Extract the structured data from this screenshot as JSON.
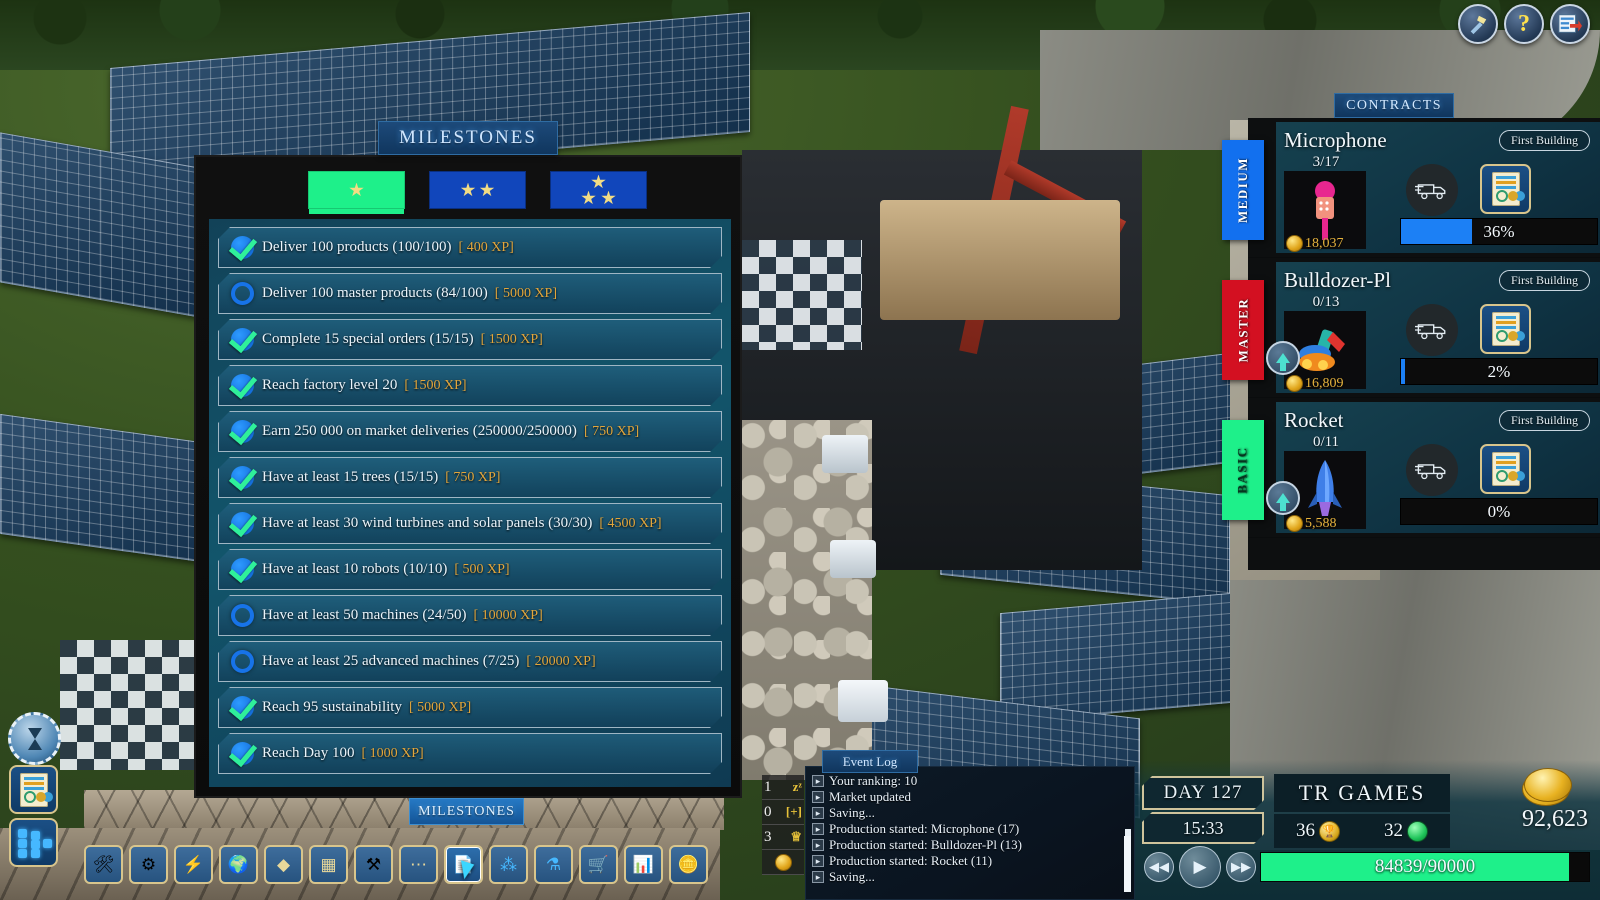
{
  "top_icons": [
    {
      "name": "hammer-tool-icon",
      "glyph": "🔨"
    },
    {
      "name": "help-icon",
      "glyph": "?"
    },
    {
      "name": "exit-icon",
      "glyph": "➡"
    }
  ],
  "milestones": {
    "window_title": "MILESTONES",
    "bottom_label": "MILESTONES",
    "tabs": [
      {
        "label": "1-star",
        "stars": 1,
        "active": true
      },
      {
        "label": "2-star",
        "stars": 2,
        "active": false
      },
      {
        "label": "3-star",
        "stars": 3,
        "active": false
      }
    ],
    "items": [
      {
        "text": "Deliver 100 products (100/100)",
        "xp": "[ 400 XP]",
        "done": true
      },
      {
        "text": "Deliver 100 master products (84/100)",
        "xp": "[ 5000 XP]",
        "done": false
      },
      {
        "text": "Complete 15 special orders (15/15)",
        "xp": "[ 1500 XP]",
        "done": true
      },
      {
        "text": "Reach factory level 20",
        "xp": "[ 1500 XP]",
        "done": true
      },
      {
        "text": "Earn 250 000 on market deliveries (250000/250000)",
        "xp": "[ 750 XP]",
        "done": true
      },
      {
        "text": "Have at least 15 trees (15/15)",
        "xp": "[ 750 XP]",
        "done": true
      },
      {
        "text": "Have at least 30 wind turbines and solar panels (30/30)",
        "xp": "[ 4500 XP]",
        "done": true
      },
      {
        "text": "Have at least 10 robots (10/10)",
        "xp": "[ 500 XP]",
        "done": true
      },
      {
        "text": "Have at least 50 machines (24/50)",
        "xp": "[ 10000 XP]",
        "done": false
      },
      {
        "text": "Have at least 25 advanced machines (7/25)",
        "xp": "[ 20000 XP]",
        "done": false
      },
      {
        "text": "Reach 95 sustainability",
        "xp": "[ 5000 XP]",
        "done": true
      },
      {
        "text": "Reach Day 100",
        "xp": "[ 1000 XP]",
        "done": true
      }
    ]
  },
  "contracts": {
    "title": "CONTRACTS",
    "rows": [
      {
        "tier": "MEDIUM",
        "tier_color": "#1270ef",
        "name": "Microphone",
        "badge": "First Building",
        "count": "3/17",
        "cost": "18,037",
        "progress_pct": "36%",
        "progress_value": 36,
        "product_icon": "microphone-icon",
        "has_upgrade": false
      },
      {
        "tier": "MASTER",
        "tier_color": "#d31021",
        "name": "Bulldozer-Pl",
        "badge": "First Building",
        "count": "0/13",
        "cost": "16,809",
        "progress_pct": "2%",
        "progress_value": 2,
        "product_icon": "bulldozer-icon",
        "has_upgrade": true
      },
      {
        "tier": "BASIC",
        "tier_color": "#1ef08a",
        "name": "Rocket",
        "badge": "First Building",
        "count": "0/11",
        "cost": "5,588",
        "progress_pct": "0%",
        "progress_value": 0,
        "product_icon": "rocket-icon",
        "has_upgrade": true
      }
    ]
  },
  "event_log": {
    "title": "Event Log",
    "lines": [
      "Your ranking: 10",
      "Market updated",
      "Saving...",
      "Production started: Microphone (17)",
      "Production started: Bulldozer-Pl (13)",
      "Production started: Rocket (11)",
      "Saving..."
    ]
  },
  "mini_counters": [
    {
      "value": "1",
      "icon": "zzz-icon",
      "glyph": "zᶻ"
    },
    {
      "value": "0",
      "icon": "plus-icon",
      "glyph": "[+]"
    },
    {
      "value": "3",
      "icon": "crown-icon",
      "glyph": "♕"
    }
  ],
  "left_stack": [
    {
      "name": "timer-hourglass-button",
      "icon": "hourglass-icon"
    },
    {
      "name": "report-button",
      "icon": "document-chart-icon"
    },
    {
      "name": "production-network-button",
      "icon": "network-nodes-icon"
    }
  ],
  "toolbar": [
    {
      "name": "workbench-button",
      "glyph": "🛠",
      "selected": false
    },
    {
      "name": "machine-button",
      "glyph": "⚙",
      "selected": false
    },
    {
      "name": "power-button",
      "glyph": "⚡",
      "selected": false
    },
    {
      "name": "sustainability-button",
      "glyph": "🌍",
      "selected": false
    },
    {
      "name": "resources-button",
      "glyph": "◆",
      "selected": false
    },
    {
      "name": "storage-button",
      "glyph": "▦",
      "selected": false
    },
    {
      "name": "tools-button",
      "glyph": "⚒",
      "selected": false
    },
    {
      "name": "more-button",
      "glyph": "⋯",
      "selected": false
    },
    {
      "name": "milestones-button",
      "glyph": "📄",
      "selected": true
    },
    {
      "name": "network-button",
      "glyph": "⁂",
      "selected": false
    },
    {
      "name": "research-button",
      "glyph": "⚗",
      "selected": false
    },
    {
      "name": "shop-button",
      "glyph": "🛒",
      "selected": false
    },
    {
      "name": "statistics-button",
      "glyph": "📊",
      "selected": false
    },
    {
      "name": "coins-button",
      "glyph": "🪙",
      "selected": false
    }
  ],
  "hud": {
    "day": "DAY 127",
    "clock": "15:33",
    "brand": "TR GAMES",
    "trophy_count": "36",
    "globe_count": "32",
    "money": "92,623",
    "xp_label": "84839/90000",
    "xp_value": 94,
    "playback": [
      {
        "name": "rewind-button",
        "glyph": "◀◀"
      },
      {
        "name": "play-button",
        "glyph": "▶"
      },
      {
        "name": "fast-forward-button",
        "glyph": "▶▶"
      }
    ]
  },
  "colors": {
    "accent_blue": "#1c80f5",
    "accent_green": "#1ef08a",
    "gold": "#e2a63c",
    "panel_dark": "#0d0f10"
  }
}
